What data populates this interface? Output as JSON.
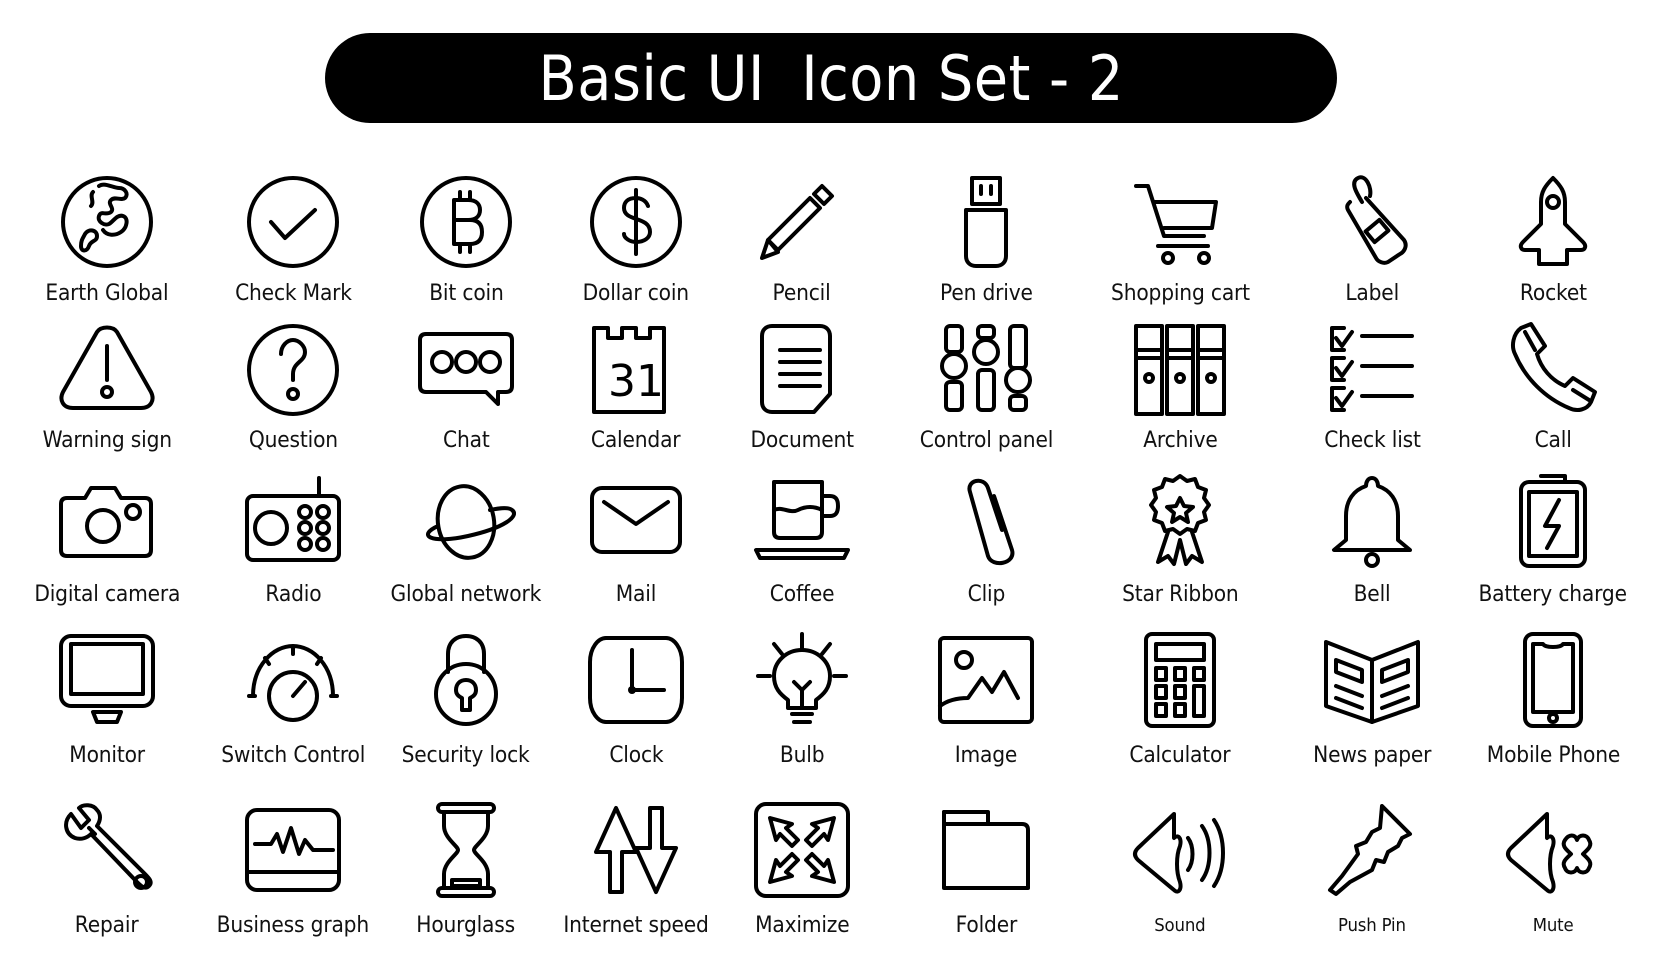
{
  "title": "Basic UI  Icon Set - 2",
  "colors": {
    "background": "#ffffff",
    "title_bar": "#000000",
    "title_text": "#ffffff",
    "icon_stroke": "#000000"
  },
  "rows": [
    [
      {
        "label": "Earth Global",
        "icon": "earth-globe-icon"
      },
      {
        "label": "Check Mark",
        "icon": "check-mark-icon"
      },
      {
        "label": "Bit coin",
        "icon": "bitcoin-icon"
      },
      {
        "label": "Dollar coin",
        "icon": "dollar-coin-icon"
      },
      {
        "label": "Pencil",
        "icon": "pencil-icon"
      },
      {
        "label": "Pen drive",
        "icon": "usb-drive-icon"
      },
      {
        "label": "Shopping cart",
        "icon": "shopping-cart-icon"
      },
      {
        "label": "Label",
        "icon": "tag-label-icon"
      },
      {
        "label": "Rocket",
        "icon": "rocket-icon"
      }
    ],
    [
      {
        "label": "Warning sign",
        "icon": "warning-icon"
      },
      {
        "label": "Question",
        "icon": "question-icon"
      },
      {
        "label": "Chat",
        "icon": "chat-bubble-icon"
      },
      {
        "label": "Calendar",
        "icon": "calendar-icon",
        "calendar_day": "31"
      },
      {
        "label": "Document",
        "icon": "document-icon"
      },
      {
        "label": "Control panel",
        "icon": "sliders-icon"
      },
      {
        "label": "Archive",
        "icon": "archive-binders-icon"
      },
      {
        "label": "Check list",
        "icon": "checklist-icon"
      },
      {
        "label": "Call",
        "icon": "phone-handset-icon"
      }
    ],
    [
      {
        "label": "Digital camera",
        "icon": "camera-icon"
      },
      {
        "label": "Radio",
        "icon": "radio-icon"
      },
      {
        "label": "Global network",
        "icon": "planet-icon"
      },
      {
        "label": "Mail",
        "icon": "mail-envelope-icon"
      },
      {
        "label": "Coffee",
        "icon": "coffee-cup-icon"
      },
      {
        "label": "Clip",
        "icon": "paper-clip-icon"
      },
      {
        "label": "Star Ribbon",
        "icon": "star-ribbon-icon"
      },
      {
        "label": "Bell",
        "icon": "bell-icon"
      },
      {
        "label": "Battery charge",
        "icon": "battery-charge-icon"
      }
    ],
    [
      {
        "label": "Monitor",
        "icon": "monitor-icon"
      },
      {
        "label": "Switch Control",
        "icon": "dial-knob-icon"
      },
      {
        "label": "Security lock",
        "icon": "padlock-icon"
      },
      {
        "label": "Clock",
        "icon": "clock-icon"
      },
      {
        "label": "Bulb",
        "icon": "light-bulb-icon"
      },
      {
        "label": "Image",
        "icon": "image-icon"
      },
      {
        "label": "Calculator",
        "icon": "calculator-icon"
      },
      {
        "label": "News paper",
        "icon": "newspaper-icon"
      },
      {
        "label": "Mobile Phone",
        "icon": "mobile-phone-icon"
      }
    ],
    [
      {
        "label": "Repair",
        "icon": "wrench-icon"
      },
      {
        "label": "Business graph",
        "icon": "pulse-graph-icon"
      },
      {
        "label": "Hourglass",
        "icon": "hourglass-icon"
      },
      {
        "label": "Internet speed",
        "icon": "up-down-arrows-icon"
      },
      {
        "label": "Maximize",
        "icon": "maximize-icon"
      },
      {
        "label": "Folder",
        "icon": "folder-icon"
      },
      {
        "label": "Sound",
        "icon": "speaker-sound-icon"
      },
      {
        "label": "Push Pin",
        "icon": "push-pin-icon"
      },
      {
        "label": "Mute",
        "icon": "speaker-mute-icon"
      }
    ]
  ]
}
